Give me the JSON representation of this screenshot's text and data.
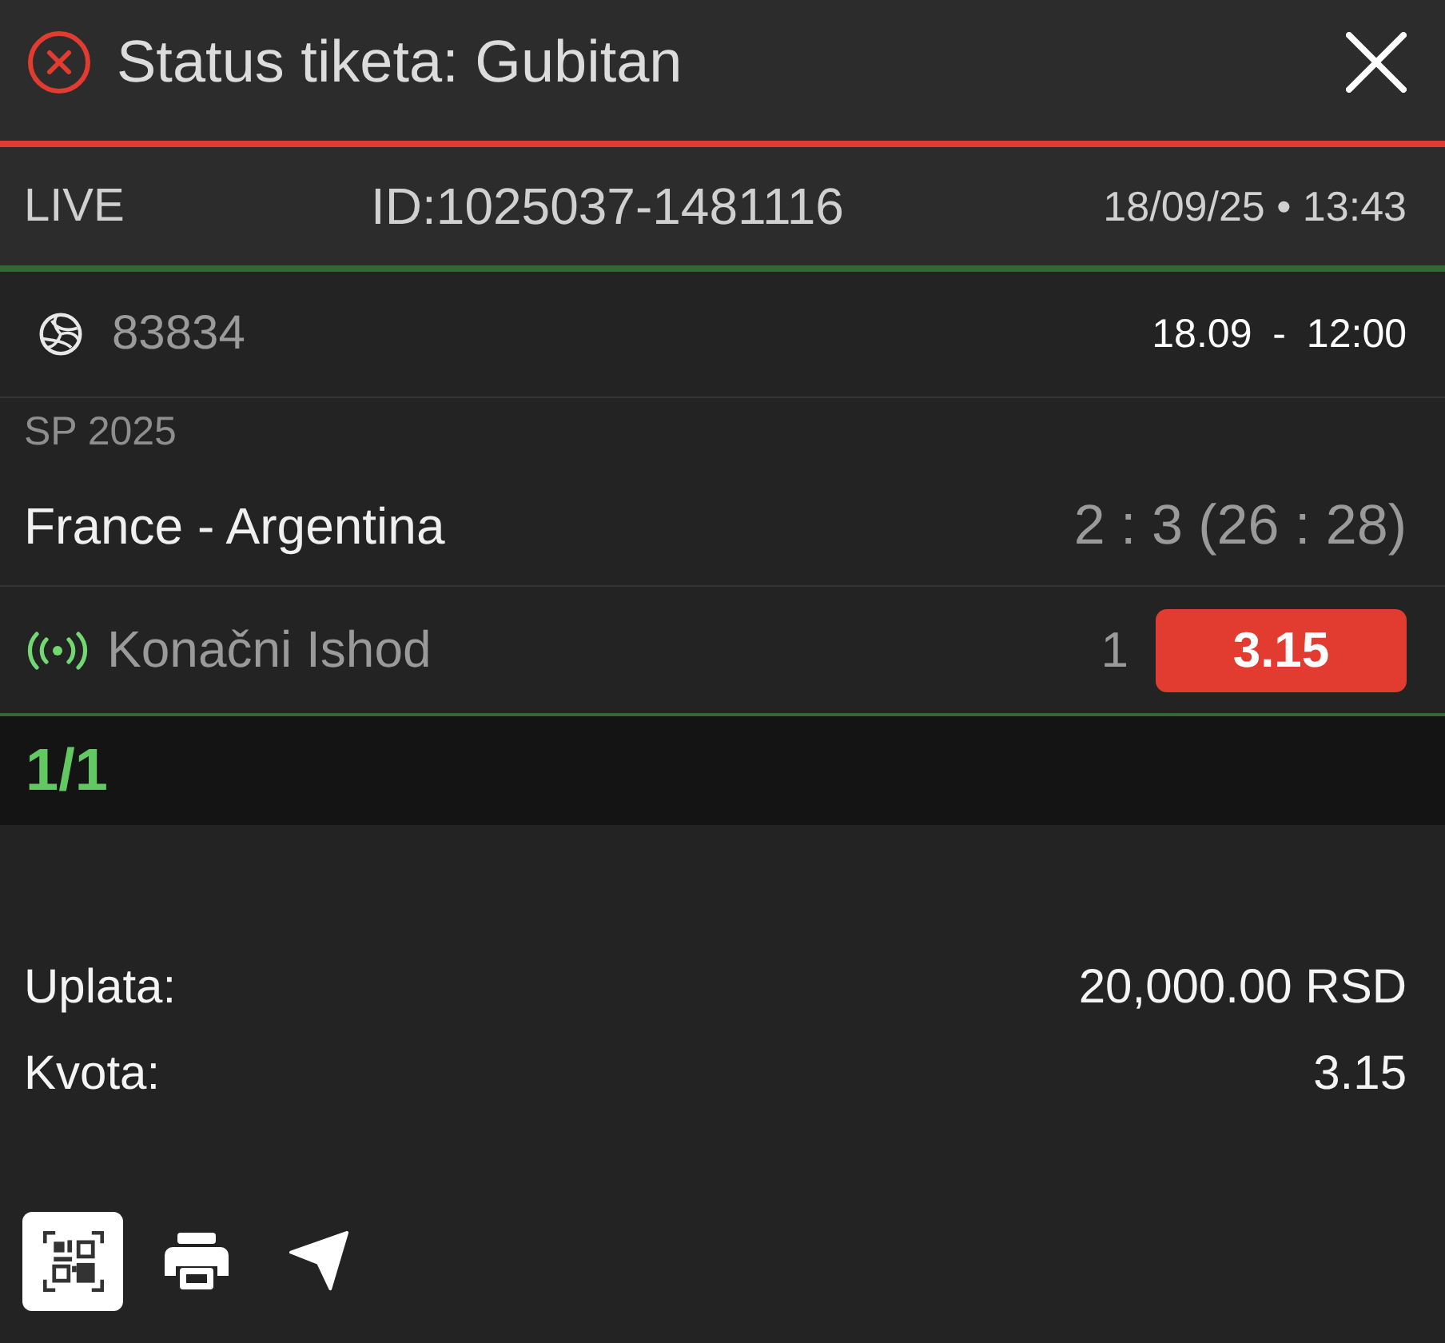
{
  "header": {
    "title": "Status tiketa: Gubitan",
    "lost": true
  },
  "ticket": {
    "type": "LIVE",
    "id": "ID:1025037-1481116",
    "datetime": "18/09/25 • 13:43"
  },
  "events": [
    {
      "code": "83834",
      "start": "18.09 - 12:00",
      "competition": "SP 2025",
      "match": "France - Argentina",
      "score": "2 : 3 (26 : 28)",
      "live": true,
      "market": "Konačni Ishod",
      "pick": "1",
      "odds": "3.15",
      "lost": true
    }
  ],
  "counter": "1/1",
  "summary": [
    {
      "label": "Uplata:",
      "value": "20,000.00 RSD"
    },
    {
      "label": "Kvota:",
      "value": "3.15"
    }
  ],
  "actions": [
    {
      "kind": "qr",
      "selected": true
    },
    {
      "kind": "print",
      "selected": false
    },
    {
      "kind": "send",
      "selected": false
    }
  ]
}
